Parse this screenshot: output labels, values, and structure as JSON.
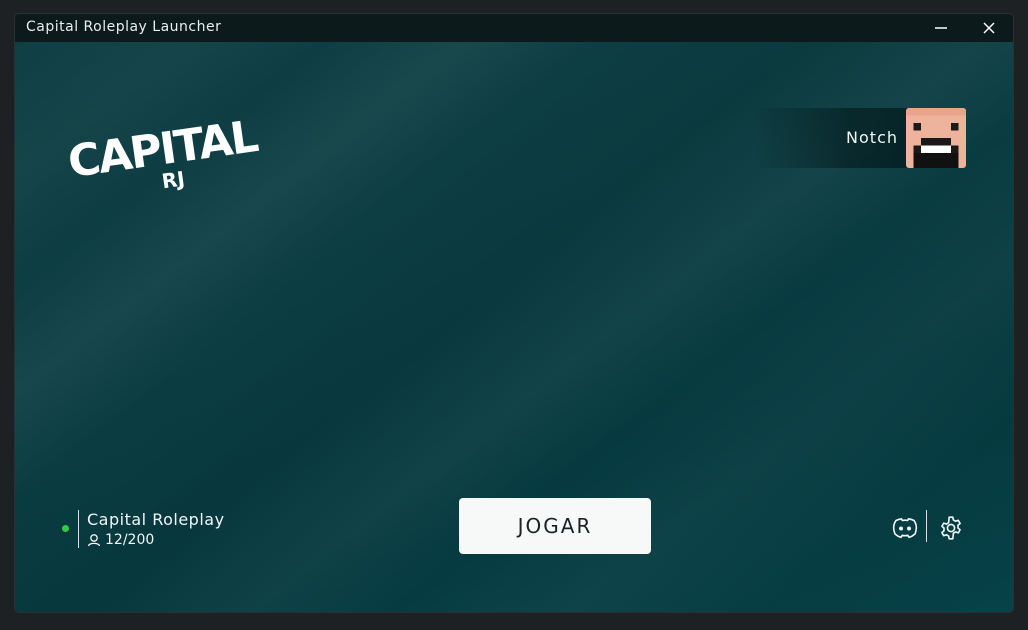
{
  "window": {
    "title": "Capital Roleplay Launcher",
    "minimize_icon": "minimize-icon",
    "close_icon": "close-icon"
  },
  "logo": {
    "line1": "CAPITAL",
    "line2": "RJ"
  },
  "user": {
    "name": "Notch",
    "avatar_icon": "player-head-avatar"
  },
  "server": {
    "name": "Capital Roleplay",
    "players": "12/200",
    "status": "online",
    "status_color": "#2ecc40",
    "players_icon": "user-icon"
  },
  "play_button": {
    "label": "JOGAR"
  },
  "footer_icons": {
    "discord": "discord-icon",
    "settings": "gear-icon"
  },
  "colors": {
    "background": "#0b3d42",
    "titlebar": "#0d1a1c",
    "button_bg": "#f7f8f8",
    "text": "#f2f5f5"
  }
}
